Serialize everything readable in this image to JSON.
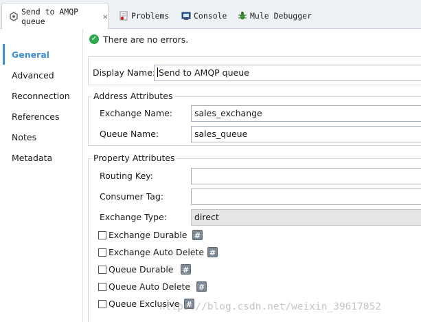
{
  "tabs": [
    {
      "label": "Send to AMQP queue",
      "icon": "flow-element-icon",
      "active": true
    },
    {
      "label": "Problems",
      "icon": "problems-icon"
    },
    {
      "label": "Console",
      "icon": "console-icon"
    },
    {
      "label": "Mule Debugger",
      "icon": "debugger-bug-icon"
    }
  ],
  "nav": {
    "items": [
      "General",
      "Advanced",
      "Reconnection",
      "References",
      "Notes",
      "Metadata"
    ],
    "active": "General"
  },
  "status": {
    "message": "There are no errors.",
    "icon": "check-ok-icon"
  },
  "general": {
    "display_name_label": "Display Name:",
    "display_name_value": "Send to AMQP queue"
  },
  "address": {
    "legend": "Address Attributes",
    "exchange_name_label": "Exchange Name:",
    "exchange_name_value": "sales_exchange",
    "queue_name_label": "Queue Name:",
    "queue_name_value": "sales_queue"
  },
  "property": {
    "legend": "Property Attributes",
    "routing_key_label": "Routing Key:",
    "routing_key_value": "",
    "consumer_tag_label": "Consumer Tag:",
    "consumer_tag_value": "",
    "exchange_type_label": "Exchange Type:",
    "exchange_type_value": "direct",
    "checkboxes": [
      {
        "label": "Exchange Durable",
        "checked": false
      },
      {
        "label": "Exchange Auto Delete",
        "checked": false
      },
      {
        "label": "Queue Durable",
        "checked": false
      },
      {
        "label": "Queue Auto Delete",
        "checked": false
      },
      {
        "label": "Queue Exclusive",
        "checked": false
      }
    ],
    "expression_button_glyph": "#"
  },
  "watermark": "https://blog.csdn.net/weixin_39617052",
  "colors": {
    "accent": "#3d8fd6",
    "ok": "#2fa84f"
  }
}
